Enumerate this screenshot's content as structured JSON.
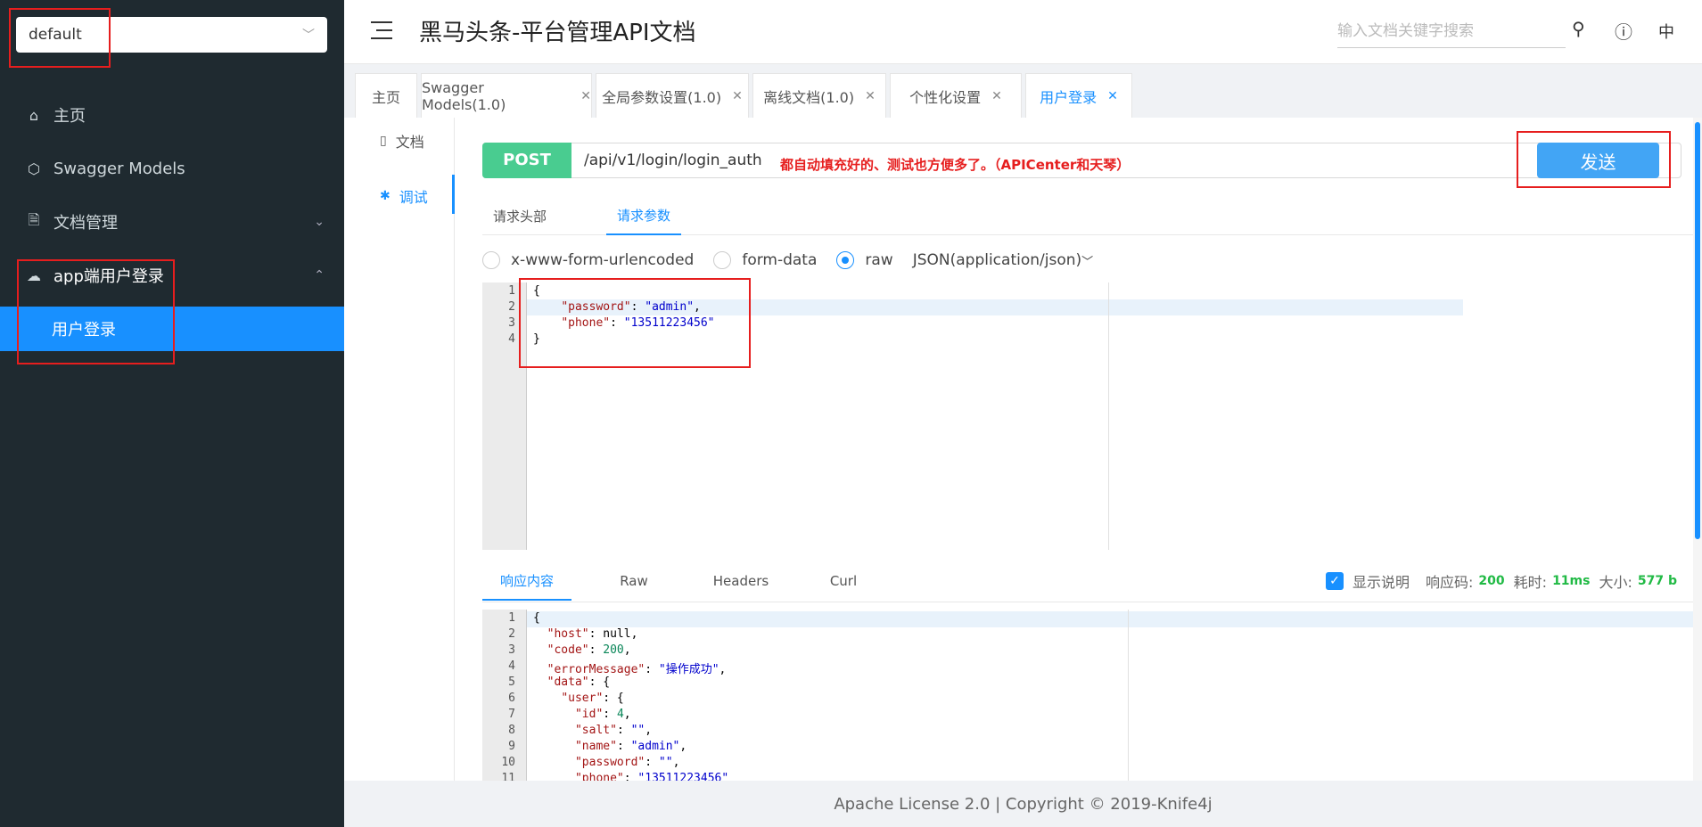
{
  "sidebar": {
    "group_select": "default",
    "items": [
      {
        "label": "主页",
        "icon": "home-icon"
      },
      {
        "label": "Swagger Models",
        "icon": "cube-icon"
      },
      {
        "label": "文档管理",
        "icon": "doc-settings-icon"
      },
      {
        "label": "app端用户登录",
        "icon": "cloud-icon"
      }
    ],
    "active_sub": "用户登录"
  },
  "header": {
    "title": "黑马头条-平台管理API文档",
    "search_placeholder": "输入文档关键字搜索",
    "lang": "中"
  },
  "tabs": [
    {
      "label": "主页"
    },
    {
      "label": "Swagger Models(1.0)"
    },
    {
      "label": "全局参数设置(1.0)"
    },
    {
      "label": "离线文档(1.0)"
    },
    {
      "label": "个性化设置"
    },
    {
      "label": "用户登录"
    }
  ],
  "leftnav": {
    "doc": "文档",
    "debug": "调试"
  },
  "request": {
    "method": "POST",
    "url": "/api/v1/login/login_auth",
    "annotation": "都自动填充好的、测试也方便多了。（APICenter和天琴）",
    "send": "发送"
  },
  "param_tabs": [
    "请求头部",
    "请求参数"
  ],
  "body_types": {
    "urlencoded": "x-www-form-urlencoded",
    "formdata": "form-data",
    "raw": "raw",
    "content_type": "JSON(application/json)"
  },
  "request_body": {
    "line_numbers": [
      "1",
      "2",
      "3",
      "4"
    ],
    "open": "{",
    "password_key": "\"password\"",
    "password_val": "\"admin\"",
    "phone_key": "\"phone\"",
    "phone_val": "\"13511223456\"",
    "close": "}"
  },
  "response": {
    "tabs": [
      "响应内容",
      "Raw",
      "Headers",
      "Curl"
    ],
    "show_desc": "显示说明",
    "code_label": "响应码:",
    "code": "200",
    "time_label": "耗时:",
    "time": "11ms",
    "size_label": "大小:",
    "size": "577 b",
    "line_numbers": [
      "1",
      "2",
      "3",
      "4",
      "5",
      "6",
      "7",
      "8",
      "9",
      "10",
      "11"
    ],
    "lines": {
      "l1": "{",
      "host_key": "\"host\"",
      "host_val": "null",
      "code_key": "\"code\"",
      "code_val": "200",
      "err_key": "\"errorMessage\"",
      "err_val": "\"操作成功\"",
      "data_key": "\"data\"",
      "user_key": "\"user\"",
      "id_key": "\"id\"",
      "id_val": "4",
      "salt_key": "\"salt\"",
      "salt_val": "\"\"",
      "name_key": "\"name\"",
      "name_val": "\"admin\"",
      "pwd_key": "\"password\"",
      "pwd_val": "\"\"",
      "phone_key": "\"phone\"",
      "phone_val": "\"13511223456\""
    }
  },
  "footer": "Apache License 2.0 | Copyright © 2019-Knife4j"
}
